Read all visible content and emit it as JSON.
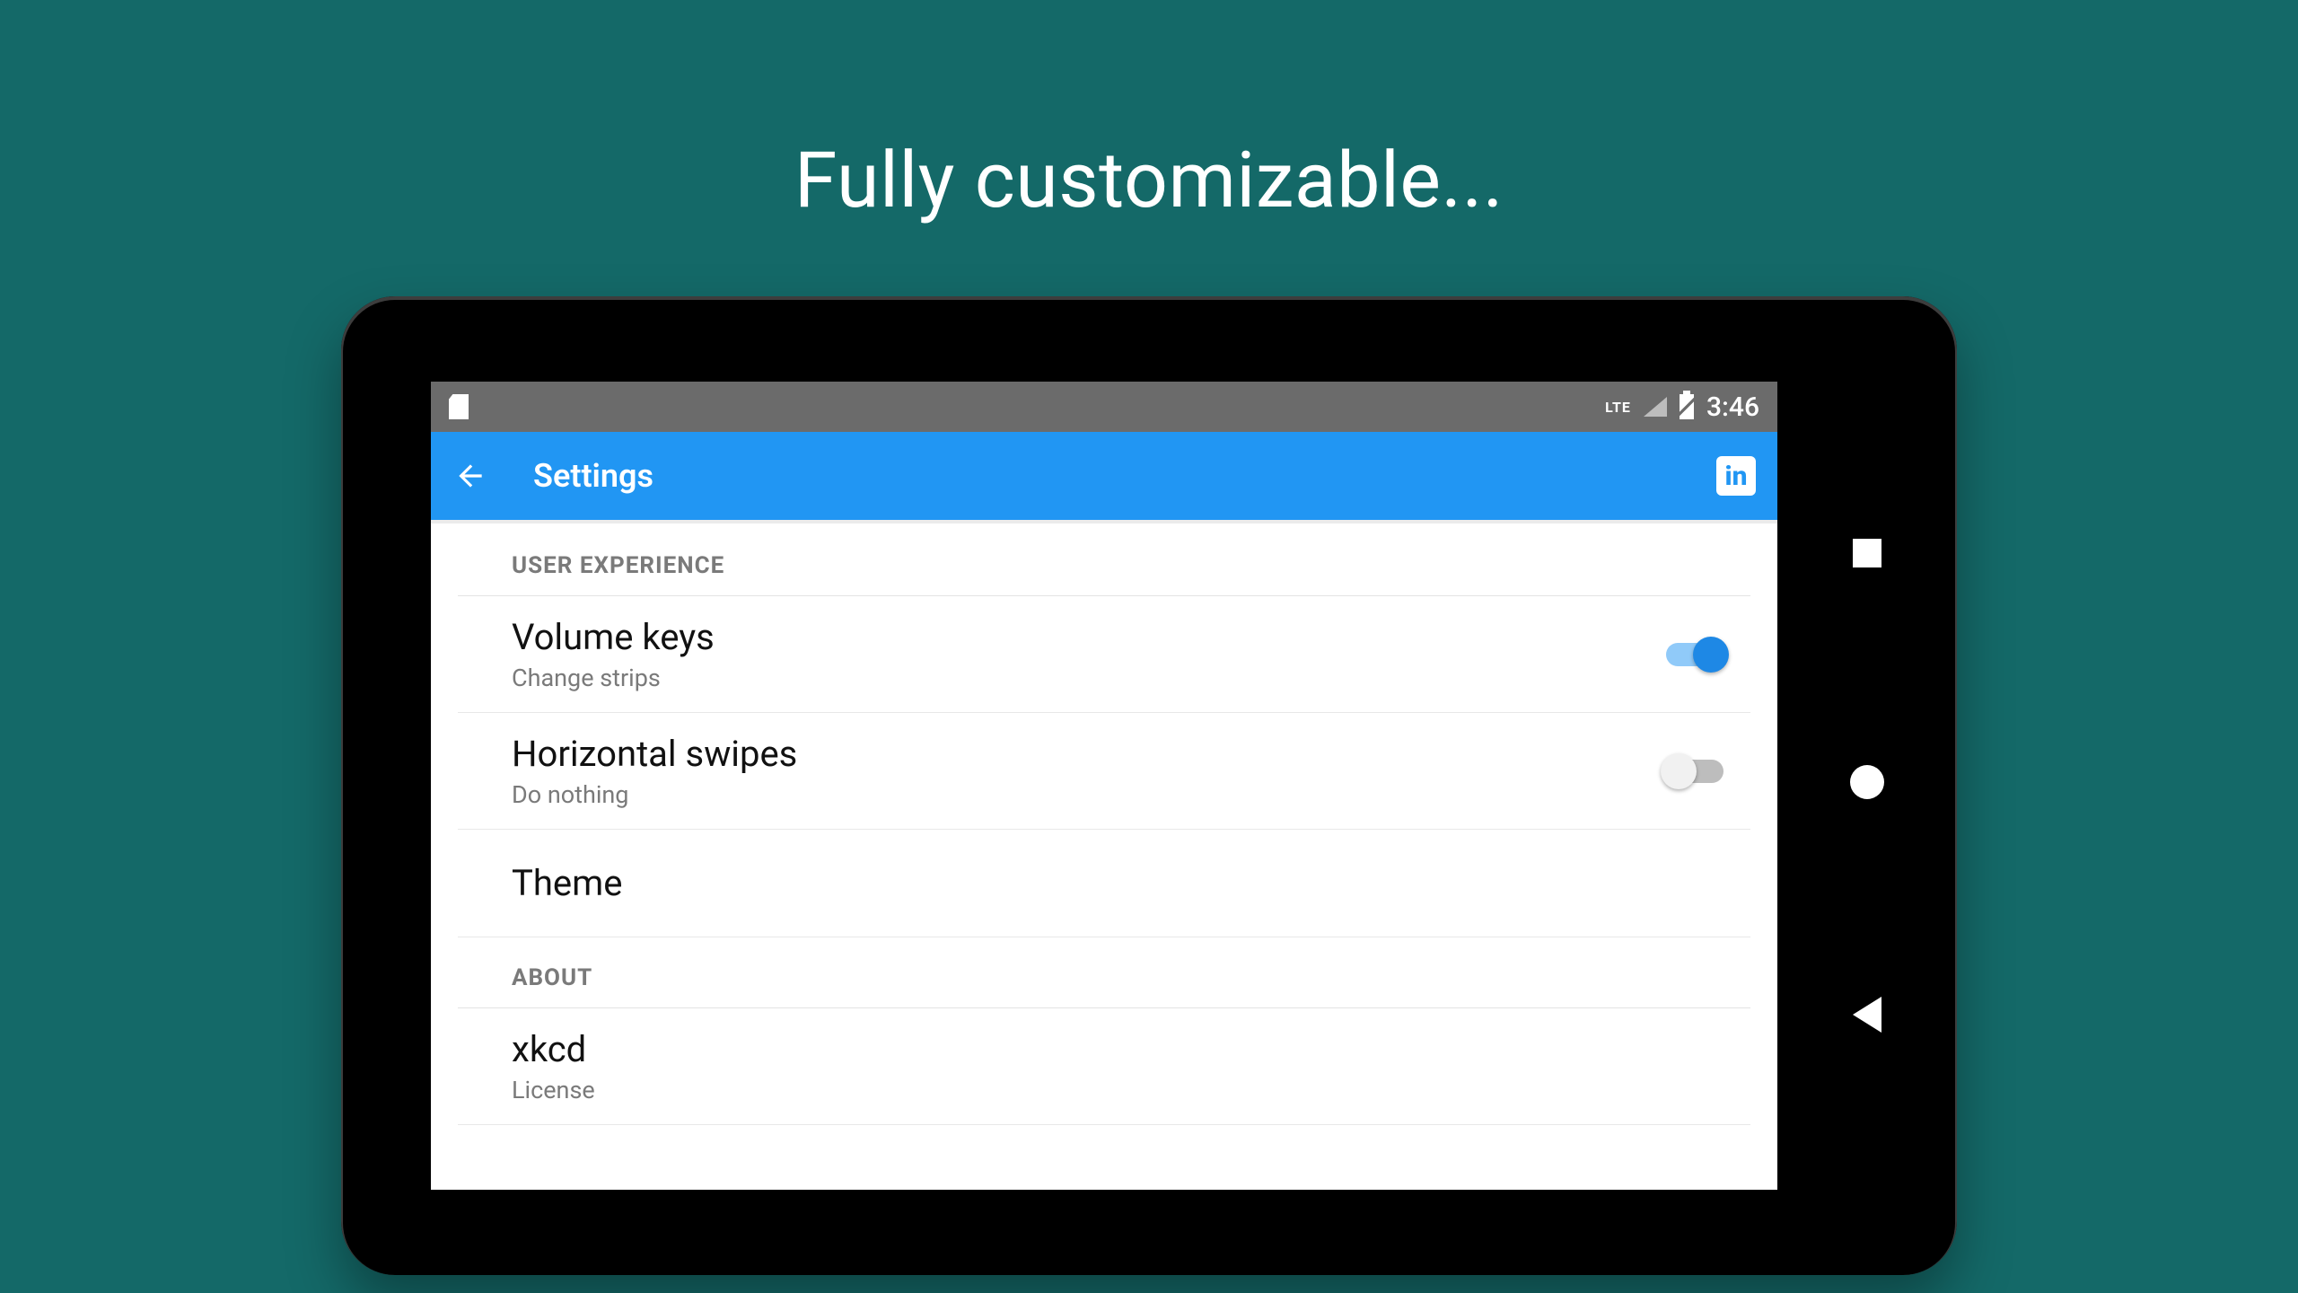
{
  "headline": "Fully customizable...",
  "statusbar": {
    "network_label": "LTE",
    "time": "3:46"
  },
  "appbar": {
    "title": "Settings"
  },
  "sections": {
    "user_experience": {
      "header": "USER EXPERIENCE",
      "volume_keys": {
        "title": "Volume keys",
        "subtitle": "Change strips",
        "enabled": true
      },
      "horizontal_swipes": {
        "title": "Horizontal swipes",
        "subtitle": "Do nothing",
        "enabled": false
      },
      "theme": {
        "title": "Theme"
      }
    },
    "about": {
      "header": "ABOUT",
      "xkcd": {
        "title": "xkcd",
        "subtitle": "License"
      }
    }
  }
}
